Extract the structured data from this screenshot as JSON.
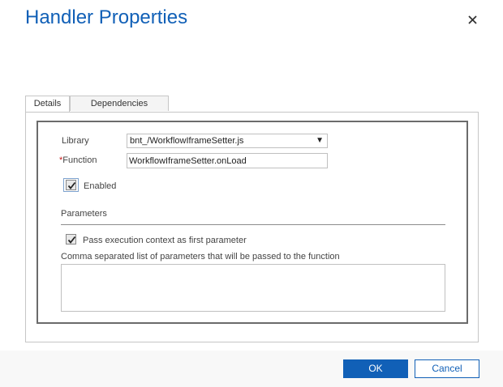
{
  "dialog": {
    "title": "Handler Properties",
    "close_icon": "close-icon"
  },
  "tabs": [
    {
      "label": "Details",
      "active": true
    },
    {
      "label": "Dependencies",
      "active": false
    }
  ],
  "details": {
    "library_label": "Library",
    "library_value": "bnt_/WorkflowIframeSetter.js",
    "function_required_marker": "*",
    "function_label": "Function",
    "function_value": "WorkflowIframeSetter.onLoad",
    "enabled_label": "Enabled",
    "enabled_checked": true,
    "parameters_heading": "Parameters",
    "pass_context_label": "Pass execution context as first parameter",
    "pass_context_checked": true,
    "params_list_label": "Comma separated list of parameters that will be passed to the function",
    "params_list_value": ""
  },
  "footer": {
    "ok_label": "OK",
    "cancel_label": "Cancel"
  },
  "colors": {
    "accent": "#1160b7",
    "required": "#c41c1c"
  }
}
